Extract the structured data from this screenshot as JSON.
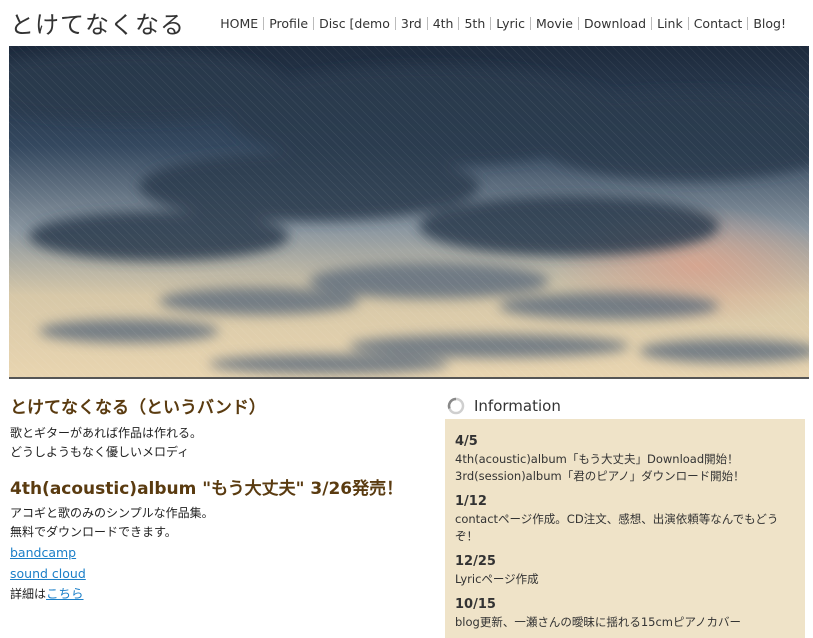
{
  "header": {
    "site_title": "とけてなくなる",
    "nav": [
      "HOME",
      "Profile",
      "Disc [demo",
      "3rd",
      "4th",
      "5th",
      "Lyric",
      "Movie",
      "Download",
      "Link",
      "Contact",
      "Blog!"
    ]
  },
  "hero": {
    "alt_icon": "sky-clouds-photo"
  },
  "left": {
    "band_title": "とけてなくなる（というバンド）",
    "band_lines": [
      "歌とギターがあれば作品は作れる。",
      "どうしようもなく優しいメロディ"
    ],
    "news_title": "4th(acoustic)album \"もう大丈夫\" 3/26発売！",
    "news_lines": [
      "アコギと歌のみのシンプルな作品集。",
      "無料でダウンロードできます。"
    ],
    "links": [
      "bandcamp",
      "sound cloud"
    ],
    "details_prefix": "詳細は",
    "details_link": "こちら"
  },
  "information": {
    "title": "Information",
    "entries": [
      {
        "date": "4/5",
        "lines": [
          "4th(acoustic)album「もう大丈夫」Download開始！",
          "3rd(session)album「君のピアノ」ダウンロード開始！"
        ]
      },
      {
        "date": "1/12",
        "lines": [
          "contactページ作成。CD注文、感想、出演依頼等なんでもどうぞ！"
        ]
      },
      {
        "date": "12/25",
        "lines": [
          "Lyricページ作成"
        ]
      },
      {
        "date": "10/15",
        "lines": [
          "blog更新、一瀬さんの曖昧に揺れる15cmピアノカバー"
        ]
      }
    ]
  },
  "colors": {
    "heading": "#5a3b10",
    "link": "#1b7fc8",
    "info_bg": "#efe3c8"
  }
}
